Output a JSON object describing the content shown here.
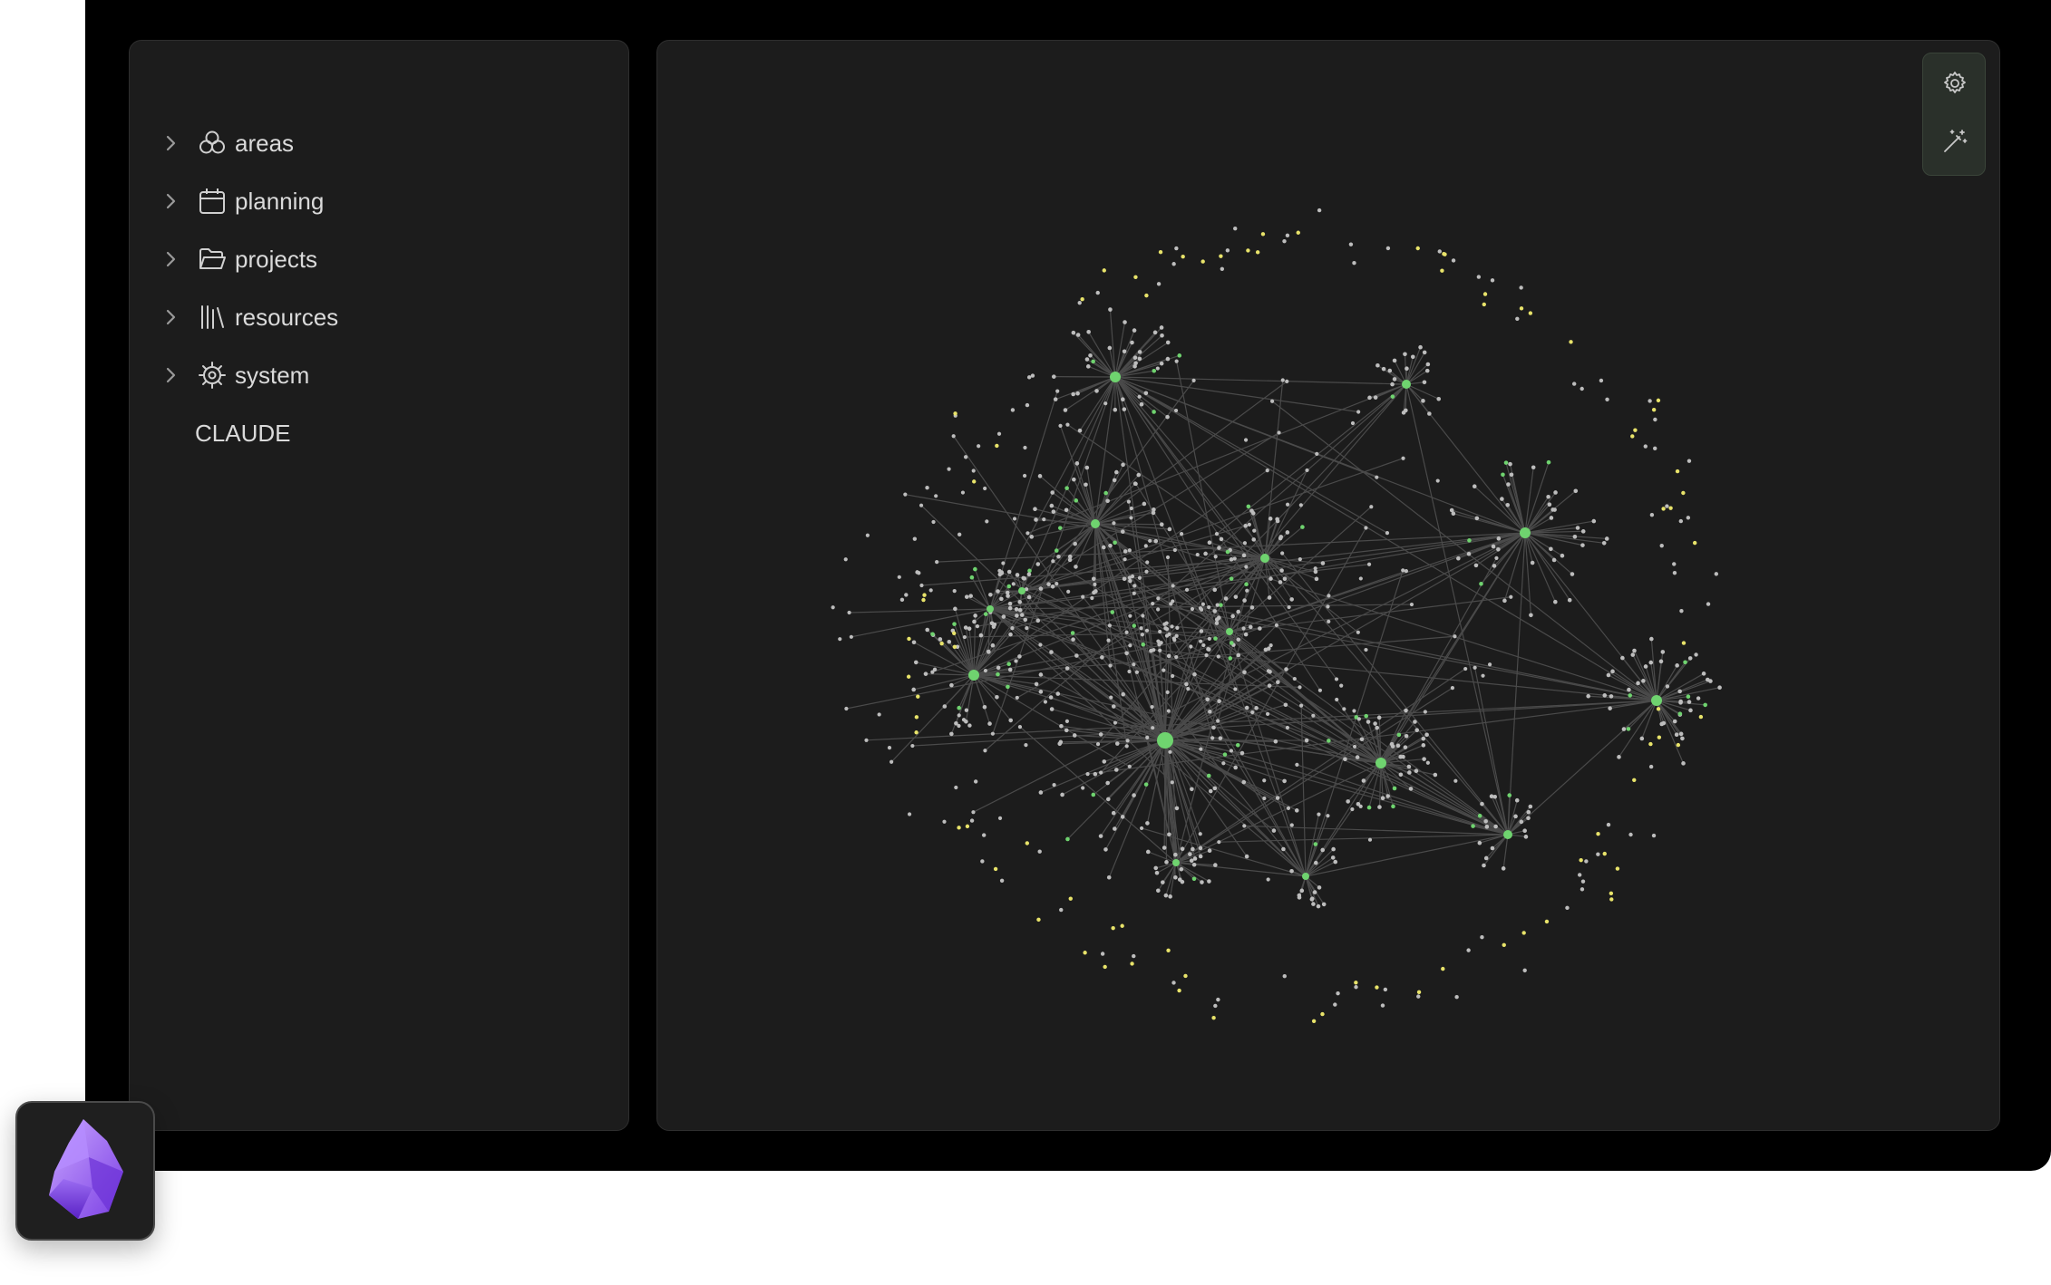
{
  "sidebar": {
    "items": [
      {
        "label": "areas",
        "icon": "areas-icon",
        "expandable": true
      },
      {
        "label": "planning",
        "icon": "calendar-icon",
        "expandable": true
      },
      {
        "label": "projects",
        "icon": "folder-open-icon",
        "expandable": true
      },
      {
        "label": "resources",
        "icon": "library-icon",
        "expandable": true
      },
      {
        "label": "system",
        "icon": "gear-icon",
        "expandable": true
      },
      {
        "label": "CLAUDE",
        "icon": null,
        "expandable": false
      }
    ]
  },
  "graph": {
    "controls": [
      {
        "icon": "settings-icon"
      },
      {
        "icon": "magic-wand-icon"
      }
    ],
    "colors": {
      "node": "#bdbdbd",
      "tag_node": "#6fd36f",
      "orphan_node": "#e8e36a",
      "edge": "#4a4a4a"
    }
  },
  "app": {
    "icon": "obsidian-logo-icon"
  }
}
